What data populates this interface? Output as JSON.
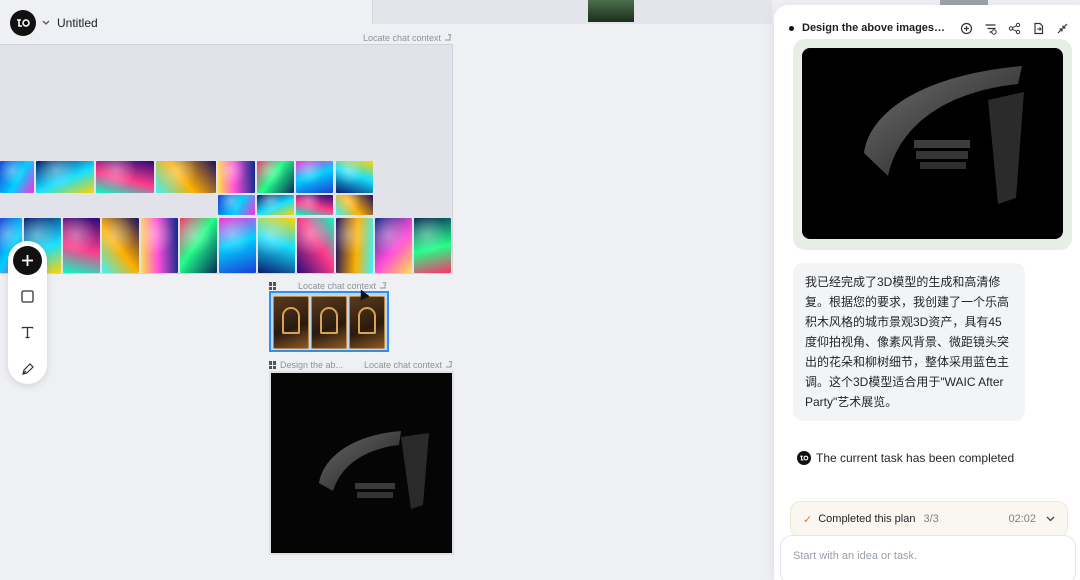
{
  "app": {
    "title": "Untitled"
  },
  "canvas": {
    "frames": [
      {
        "label": "Locate chat context"
      },
      {
        "label": "Locate chat context"
      },
      {
        "title": "Design the ab...",
        "label": "Locate chat context"
      }
    ]
  },
  "panel": {
    "title": "Design the above images a...",
    "message": "我已经完成了3D模型的生成和高清修复。根据您的要求，我创建了一个乐高积木风格的城市景观3D资产，具有45度仰拍视角、像素风背景、微距镜头突出的花朵和柳树细节，整体采用蓝色主调。这个3D模型适合用于\"WAIC After Party\"艺术展览。",
    "status": "The current task has been completed",
    "plan": {
      "label": "Completed this plan",
      "count": "3/3",
      "time": "02:02"
    },
    "input_placeholder": "Start with an idea or task."
  },
  "colors": {
    "accent": "#2f8ef0",
    "panel_bg": "#ffffff",
    "canvas_bg": "#eef0f4"
  }
}
